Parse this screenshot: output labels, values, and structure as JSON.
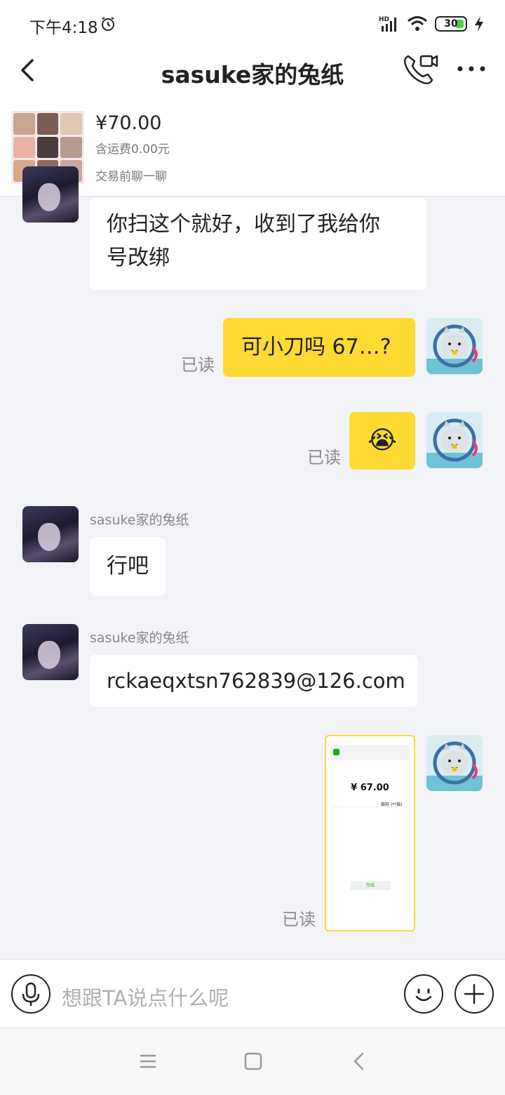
{
  "status_bar": {
    "time": "下午4:18",
    "network": "HD",
    "battery": "30"
  },
  "header": {
    "title": "sasuke家的兔纸"
  },
  "product": {
    "price": "¥70.00",
    "shipping": "含运费0.00元",
    "note": "交易前聊一聊"
  },
  "messages": [
    {
      "from": "other",
      "text": "你扫这个就好，收到了我给你号改绑",
      "line1": "你扫这个就好，收到了我给你",
      "line2": "号改绑"
    },
    {
      "from": "self",
      "text": "可小刀吗 67…?",
      "read": "已读"
    },
    {
      "from": "self",
      "type": "emoji",
      "emoji": "😭",
      "read": "已读"
    },
    {
      "from": "other",
      "sender": "sasuke家的兔纸",
      "text": "行吧"
    },
    {
      "from": "other",
      "sender": "sasuke家的兔纸",
      "text": "rckaeqxtsn762839@126.com"
    },
    {
      "from": "self",
      "type": "image",
      "read": "已读",
      "image": {
        "amount": "¥ 67.00",
        "payee": "猫呀 (**猫)",
        "button": "完成"
      }
    }
  ],
  "input": {
    "placeholder": "想跟TA说点什么呢"
  },
  "colors": {
    "accent": "#ffda33",
    "background": "#f2f3f7"
  }
}
